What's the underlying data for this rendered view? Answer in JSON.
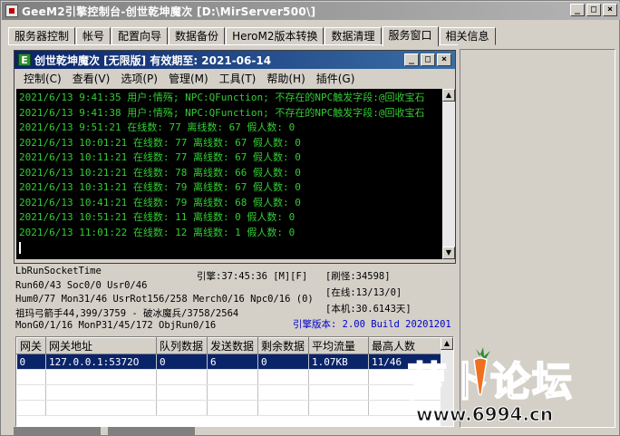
{
  "window": {
    "title": "GeeM2引擎控制台-创世乾坤魔次 [D:\\MirServer500\\]",
    "controls": [
      "_",
      "□",
      "×"
    ]
  },
  "tabs": [
    {
      "label": "服务器控制"
    },
    {
      "label": "帐号"
    },
    {
      "label": "配置向导"
    },
    {
      "label": "数据备份"
    },
    {
      "label": "HeroM2版本转换"
    },
    {
      "label": "数据清理"
    },
    {
      "label": "服务窗口",
      "active": true
    },
    {
      "label": "相关信息"
    }
  ],
  "inner_window": {
    "title": "创世乾坤魔次 [无限版] 有效期至: 2021-06-14",
    "icon_letter": "E",
    "menus": [
      "控制(C)",
      "查看(V)",
      "选项(P)",
      "管理(M)",
      "工具(T)",
      "帮助(H)",
      "插件(G)"
    ],
    "log_lines": [
      "2021/6/13 9:41:35 用户:情殇; NPC:QFunction; 不存在的NPC触发字段:@回收宝石",
      "2021/6/13 9:41:38 用户:情殇; NPC:QFunction; 不存在的NPC触发字段:@回收宝石",
      "2021/6/13 9:51:21 在线数: 77 离线数: 67 假人数: 0",
      "2021/6/13 10:01:21 在线数: 77 离线数: 67 假人数: 0",
      "2021/6/13 10:11:21 在线数: 77 离线数: 67 假人数: 0",
      "2021/6/13 10:21:21 在线数: 78 离线数: 66 假人数: 0",
      "2021/6/13 10:31:21 在线数: 79 离线数: 67 假人数: 0",
      "2021/6/13 10:41:21 在线数: 79 离线数: 68 假人数: 0",
      "2021/6/13 10:51:21 在线数: 11 离线数: 0 假人数: 0",
      "2021/6/13 11:01:22 在线数: 12 离线数: 1 假人数: 0"
    ]
  },
  "status": {
    "socket": "LbRunSocketTime",
    "engine_time": "引擎:37:45:36 [M][F]",
    "refresh": "[刷怪:34598]",
    "run": "Run60/43 Soc0/0 Usr0/46",
    "online": "[在线:13/13/0]",
    "hum": "Hum0/77 Mon31/46 UsrRot156/258 Merch0/16 Npc0/16 (0)",
    "local": "[本机:30.6143天]",
    "player": "祖玛弓箭手44,399/3759 - 破冰魔兵/3758/2564",
    "mon": "MonG0/1/16 MonP31/45/172 ObjRun0/16",
    "version": "引擎版本: 2.00 Build 20201201"
  },
  "gateway_table": {
    "columns": [
      "网关",
      "网关地址",
      "队列数据",
      "发送数据",
      "剩余数据",
      "平均流量",
      "最高人数"
    ],
    "rows": [
      [
        "0",
        "127.0.0.1:5372O",
        "0",
        "6",
        "0",
        "1.07KB",
        "11/46"
      ]
    ]
  },
  "watermark": {
    "title": "萝卜论坛",
    "url": "www.6994.cn"
  },
  "colors": {
    "log_text": "#33cc33",
    "version_text": "#0000cc",
    "inner_titlebar": "#0a246a"
  }
}
